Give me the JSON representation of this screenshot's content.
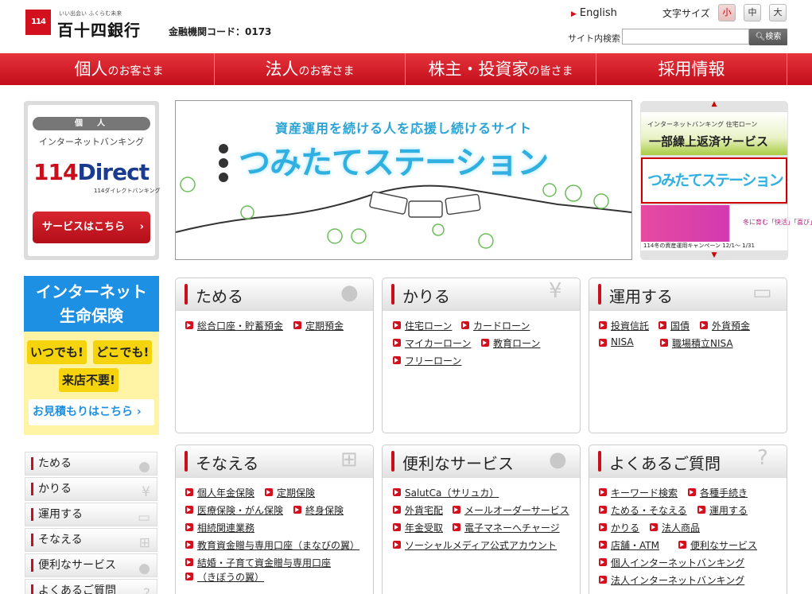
{
  "header": {
    "logo_mark": "114",
    "logo_tagline": "いい出会い ふくらむ未来",
    "logo_name": "百十四銀行",
    "institution_code": "金融機関コード：0173",
    "english_link": "English",
    "font_size_label": "文字サイズ",
    "font_size_small": "小",
    "font_size_medium": "中",
    "font_size_large": "大",
    "search_label": "サイト内検索",
    "search_button": "検索"
  },
  "nav": [
    {
      "big": "個人",
      "small": "のお客さま"
    },
    {
      "big": "法人",
      "small": "のお客さま"
    },
    {
      "big": "株主・投資家",
      "small": "の皆さま"
    },
    {
      "big": "採用情報",
      "small": ""
    }
  ],
  "ib_box": {
    "pill": "個　人",
    "subtitle": "インターネットバンキング",
    "logo_num": "114",
    "logo_d": "D",
    "logo_rest": "irect",
    "logo_sub": "114ダイレクトバンキング",
    "button": "サービスはこちら"
  },
  "banner": {
    "top_text": "資産運用を続ける人を応援し続けるサイト",
    "title": "つみたてステーション"
  },
  "thumbs": {
    "t1_small": "インターネットバンキング 住宅ローン",
    "t1_big": "一部繰上返済サービス",
    "t2": "つみたてステーション",
    "t3_text": "冬に育む「快活」「喜び」「元気」",
    "t3_caption": "114冬の資産運用キャンペーン 12/1〜 1/31"
  },
  "life": {
    "heading1": "インターネット",
    "heading2": "生命保険",
    "chip1": "いつでも!",
    "chip2": "どこでも!",
    "chip3": "来店不要!",
    "link": "お見積もりはこちら"
  },
  "left_menu": [
    "ためる",
    "かりる",
    "運用する",
    "そなえる",
    "便利なサービス",
    "よくあるご質問"
  ],
  "panels": {
    "tameru": {
      "title": "ためる",
      "links": [
        "総合口座・貯蓄預金",
        "定期預金"
      ]
    },
    "kariru": {
      "title": "かりる",
      "links": [
        "住宅ローン",
        "カードローン",
        "マイカーローン",
        "教育ローン",
        "フリーローン"
      ]
    },
    "unyou": {
      "title": "運用する",
      "links": [
        "投資信託",
        "国債",
        "外貨預金",
        "NISA",
        "職場積立NISA"
      ]
    },
    "sonaeru": {
      "title": "そなえる",
      "links": [
        "個人年金保険",
        "定期保険",
        "医療保険・がん保険",
        "終身保険",
        "相続関連業務",
        "教育資金贈与専用口座（まなびの翼）",
        "結婚・子育て資金贈与専用口座",
        "（きぼうの翼）"
      ]
    },
    "benri": {
      "title": "便利なサービス",
      "links": [
        "SalutCa（サリュカ）",
        "外貨宅配",
        "メールオーダーサービス",
        "年金受取",
        "電子マネーへチャージ",
        "ソーシャルメディア公式アカウント"
      ]
    },
    "faq": {
      "title": "よくあるご質問",
      "links": [
        "キーワード検索",
        "各種手続き",
        "ためる・そなえる",
        "運用する",
        "かりる",
        "法人商品",
        "店舗・ATM",
        "便利なサービス",
        "個人インターネットバンキング",
        "法人インターネットバンキング"
      ]
    }
  }
}
